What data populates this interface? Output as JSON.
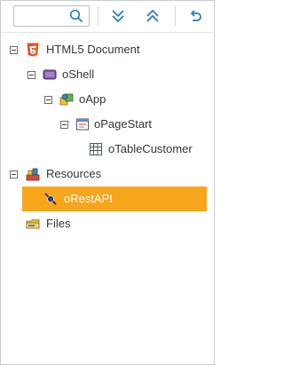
{
  "toolbar": {
    "search_value": "",
    "expand_all_icon": "double-chevron-down-icon",
    "collapse_all_icon": "double-chevron-up-icon",
    "undo_icon": "undo-arrow-icon"
  },
  "tree": {
    "nodes": [
      {
        "label": "HTML5 Document",
        "icon": "html5-icon",
        "expanded": true
      },
      {
        "label": "oShell",
        "icon": "shell-icon",
        "expanded": true
      },
      {
        "label": "oApp",
        "icon": "app-icon",
        "expanded": true
      },
      {
        "label": "oPageStart",
        "icon": "page-icon",
        "expanded": true
      },
      {
        "label": "oTableCustomer",
        "icon": "table-icon"
      },
      {
        "label": "Resources",
        "icon": "resources-icon",
        "expanded": true
      },
      {
        "label": "oRestAPI",
        "icon": "rest-api-icon",
        "selected": true
      },
      {
        "label": "Files",
        "icon": "files-icon"
      }
    ]
  },
  "colors": {
    "selection": "#f7a51a",
    "toolbar_icon": "#2b7dbc"
  }
}
